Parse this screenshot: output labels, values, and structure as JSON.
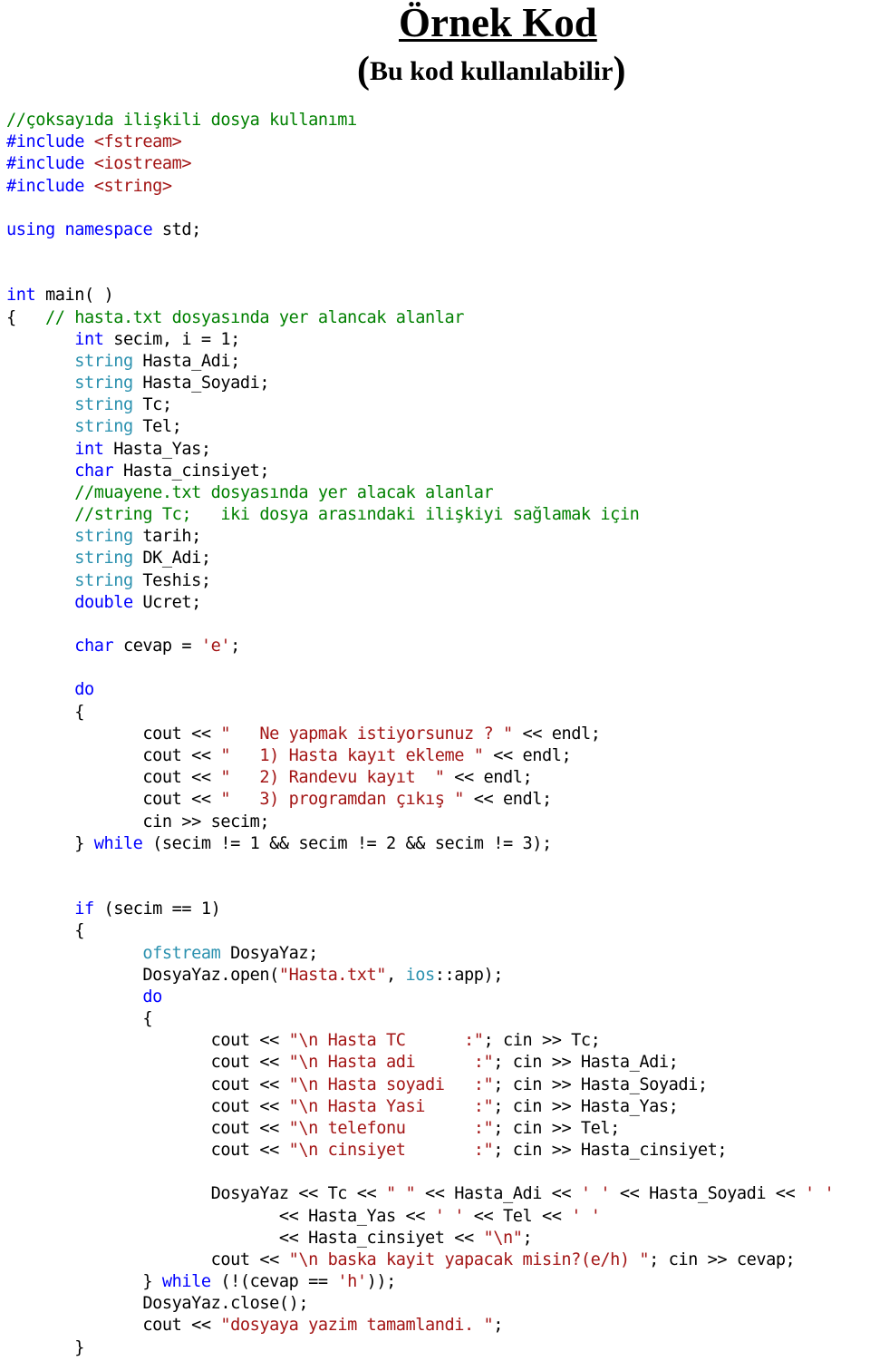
{
  "header": {
    "title": "Örnek Kod",
    "subtitle_open": "(",
    "subtitle": "Bu kod kullanılabilir",
    "subtitle_close": ")"
  },
  "colors": {
    "keyword": "#0000ff",
    "type": "#2b91af",
    "comment": "#008000",
    "string": "#a31515",
    "text": "#000000"
  },
  "code_lines": [
    [
      {
        "c": "cm",
        "t": "//çoksayıda ilişkili dosya kullanımı"
      }
    ],
    [
      {
        "c": "pp",
        "t": "#include "
      },
      {
        "c": "st",
        "t": "<fstream>"
      }
    ],
    [
      {
        "c": "pp",
        "t": "#include "
      },
      {
        "c": "st",
        "t": "<iostream>"
      }
    ],
    [
      {
        "c": "pp",
        "t": "#include "
      },
      {
        "c": "st",
        "t": "<string>"
      }
    ],
    [],
    [
      {
        "c": "kw",
        "t": "using"
      },
      {
        "c": "",
        "t": " "
      },
      {
        "c": "kw",
        "t": "namespace"
      },
      {
        "c": "",
        "t": " std;"
      }
    ],
    [],
    [],
    [
      {
        "c": "kw",
        "t": "int"
      },
      {
        "c": "",
        "t": " main( )"
      }
    ],
    [
      {
        "c": "",
        "t": "{   "
      },
      {
        "c": "cm",
        "t": "// hasta.txt dosyasında yer alancak alanlar"
      }
    ],
    [
      {
        "c": "",
        "t": "       "
      },
      {
        "c": "kw",
        "t": "int"
      },
      {
        "c": "",
        "t": " secim, i = 1;"
      }
    ],
    [
      {
        "c": "",
        "t": "       "
      },
      {
        "c": "ty",
        "t": "string"
      },
      {
        "c": "",
        "t": " Hasta_Adi;"
      }
    ],
    [
      {
        "c": "",
        "t": "       "
      },
      {
        "c": "ty",
        "t": "string"
      },
      {
        "c": "",
        "t": " Hasta_Soyadi;"
      }
    ],
    [
      {
        "c": "",
        "t": "       "
      },
      {
        "c": "ty",
        "t": "string"
      },
      {
        "c": "",
        "t": " Tc;"
      }
    ],
    [
      {
        "c": "",
        "t": "       "
      },
      {
        "c": "ty",
        "t": "string"
      },
      {
        "c": "",
        "t": " Tel;"
      }
    ],
    [
      {
        "c": "",
        "t": "       "
      },
      {
        "c": "kw",
        "t": "int"
      },
      {
        "c": "",
        "t": " Hasta_Yas;"
      }
    ],
    [
      {
        "c": "",
        "t": "       "
      },
      {
        "c": "kw",
        "t": "char"
      },
      {
        "c": "",
        "t": " Hasta_cinsiyet;"
      }
    ],
    [
      {
        "c": "",
        "t": "       "
      },
      {
        "c": "cm",
        "t": "//muayene.txt dosyasında yer alacak alanlar"
      }
    ],
    [
      {
        "c": "",
        "t": "       "
      },
      {
        "c": "cm",
        "t": "//string Tc;   iki dosya arasındaki ilişkiyi sağlamak için"
      }
    ],
    [
      {
        "c": "",
        "t": "       "
      },
      {
        "c": "ty",
        "t": "string"
      },
      {
        "c": "",
        "t": " tarih;"
      }
    ],
    [
      {
        "c": "",
        "t": "       "
      },
      {
        "c": "ty",
        "t": "string"
      },
      {
        "c": "",
        "t": " DK_Adi;"
      }
    ],
    [
      {
        "c": "",
        "t": "       "
      },
      {
        "c": "ty",
        "t": "string"
      },
      {
        "c": "",
        "t": " Teshis;"
      }
    ],
    [
      {
        "c": "",
        "t": "       "
      },
      {
        "c": "kw",
        "t": "double"
      },
      {
        "c": "",
        "t": " Ucret;"
      }
    ],
    [],
    [
      {
        "c": "",
        "t": "       "
      },
      {
        "c": "kw",
        "t": "char"
      },
      {
        "c": "",
        "t": " cevap = "
      },
      {
        "c": "st",
        "t": "'e'"
      },
      {
        "c": "",
        "t": ";"
      }
    ],
    [],
    [
      {
        "c": "",
        "t": "       "
      },
      {
        "c": "kw",
        "t": "do"
      }
    ],
    [
      {
        "c": "",
        "t": "       {"
      }
    ],
    [
      {
        "c": "",
        "t": "              cout << "
      },
      {
        "c": "st",
        "t": "\"   Ne yapmak istiyorsunuz ? \""
      },
      {
        "c": "",
        "t": " << endl;"
      }
    ],
    [
      {
        "c": "",
        "t": "              cout << "
      },
      {
        "c": "st",
        "t": "\"   1) Hasta kayıt ekleme \""
      },
      {
        "c": "",
        "t": " << endl;"
      }
    ],
    [
      {
        "c": "",
        "t": "              cout << "
      },
      {
        "c": "st",
        "t": "\"   2) Randevu kayıt  \""
      },
      {
        "c": "",
        "t": " << endl;"
      }
    ],
    [
      {
        "c": "",
        "t": "              cout << "
      },
      {
        "c": "st",
        "t": "\"   3) programdan çıkış \""
      },
      {
        "c": "",
        "t": " << endl;"
      }
    ],
    [
      {
        "c": "",
        "t": "              cin >> secim;"
      }
    ],
    [
      {
        "c": "",
        "t": "       } "
      },
      {
        "c": "kw",
        "t": "while"
      },
      {
        "c": "",
        "t": " (secim != 1 && secim != 2 && secim != 3);"
      }
    ],
    [],
    [],
    [
      {
        "c": "",
        "t": "       "
      },
      {
        "c": "kw",
        "t": "if"
      },
      {
        "c": "",
        "t": " (secim == 1)"
      }
    ],
    [
      {
        "c": "",
        "t": "       {"
      }
    ],
    [
      {
        "c": "",
        "t": "              "
      },
      {
        "c": "ty",
        "t": "ofstream"
      },
      {
        "c": "",
        "t": " DosyaYaz;"
      }
    ],
    [
      {
        "c": "",
        "t": "              DosyaYaz.open("
      },
      {
        "c": "st",
        "t": "\"Hasta.txt\""
      },
      {
        "c": "",
        "t": ", "
      },
      {
        "c": "ty",
        "t": "ios"
      },
      {
        "c": "",
        "t": "::app);"
      }
    ],
    [
      {
        "c": "",
        "t": "              "
      },
      {
        "c": "kw",
        "t": "do"
      }
    ],
    [
      {
        "c": "",
        "t": "              {"
      }
    ],
    [
      {
        "c": "",
        "t": "                     cout << "
      },
      {
        "c": "st",
        "t": "\"\\n Hasta TC      :\""
      },
      {
        "c": "",
        "t": "; cin >> Tc;"
      }
    ],
    [
      {
        "c": "",
        "t": "                     cout << "
      },
      {
        "c": "st",
        "t": "\"\\n Hasta adi      :\""
      },
      {
        "c": "",
        "t": "; cin >> Hasta_Adi;"
      }
    ],
    [
      {
        "c": "",
        "t": "                     cout << "
      },
      {
        "c": "st",
        "t": "\"\\n Hasta soyadi   :\""
      },
      {
        "c": "",
        "t": "; cin >> Hasta_Soyadi;"
      }
    ],
    [
      {
        "c": "",
        "t": "                     cout << "
      },
      {
        "c": "st",
        "t": "\"\\n Hasta Yasi     :\""
      },
      {
        "c": "",
        "t": "; cin >> Hasta_Yas;"
      }
    ],
    [
      {
        "c": "",
        "t": "                     cout << "
      },
      {
        "c": "st",
        "t": "\"\\n telefonu       :\""
      },
      {
        "c": "",
        "t": "; cin >> Tel;"
      }
    ],
    [
      {
        "c": "",
        "t": "                     cout << "
      },
      {
        "c": "st",
        "t": "\"\\n cinsiyet       :\""
      },
      {
        "c": "",
        "t": "; cin >> Hasta_cinsiyet;"
      }
    ],
    [],
    [
      {
        "c": "",
        "t": "                     DosyaYaz << Tc << "
      },
      {
        "c": "st",
        "t": "\" \""
      },
      {
        "c": "",
        "t": " << Hasta_Adi << "
      },
      {
        "c": "st",
        "t": "' '"
      },
      {
        "c": "",
        "t": " << Hasta_Soyadi << "
      },
      {
        "c": "st",
        "t": "' '"
      }
    ],
    [
      {
        "c": "",
        "t": "                            << Hasta_Yas << "
      },
      {
        "c": "st",
        "t": "' '"
      },
      {
        "c": "",
        "t": " << Tel << "
      },
      {
        "c": "st",
        "t": "' '"
      }
    ],
    [
      {
        "c": "",
        "t": "                            << Hasta_cinsiyet << "
      },
      {
        "c": "st",
        "t": "\"\\n\""
      },
      {
        "c": "",
        "t": ";"
      }
    ],
    [
      {
        "c": "",
        "t": "                     cout << "
      },
      {
        "c": "st",
        "t": "\"\\n baska kayit yapacak misin?(e/h) \""
      },
      {
        "c": "",
        "t": "; cin >> cevap;"
      }
    ],
    [
      {
        "c": "",
        "t": "              } "
      },
      {
        "c": "kw",
        "t": "while"
      },
      {
        "c": "",
        "t": " (!(cevap == "
      },
      {
        "c": "st",
        "t": "'h'"
      },
      {
        "c": "",
        "t": "));"
      }
    ],
    [
      {
        "c": "",
        "t": "              DosyaYaz.close();"
      }
    ],
    [
      {
        "c": "",
        "t": "              cout << "
      },
      {
        "c": "st",
        "t": "\"dosyaya yazim tamamlandi. \""
      },
      {
        "c": "",
        "t": ";"
      }
    ],
    [
      {
        "c": "",
        "t": "       }"
      }
    ]
  ]
}
